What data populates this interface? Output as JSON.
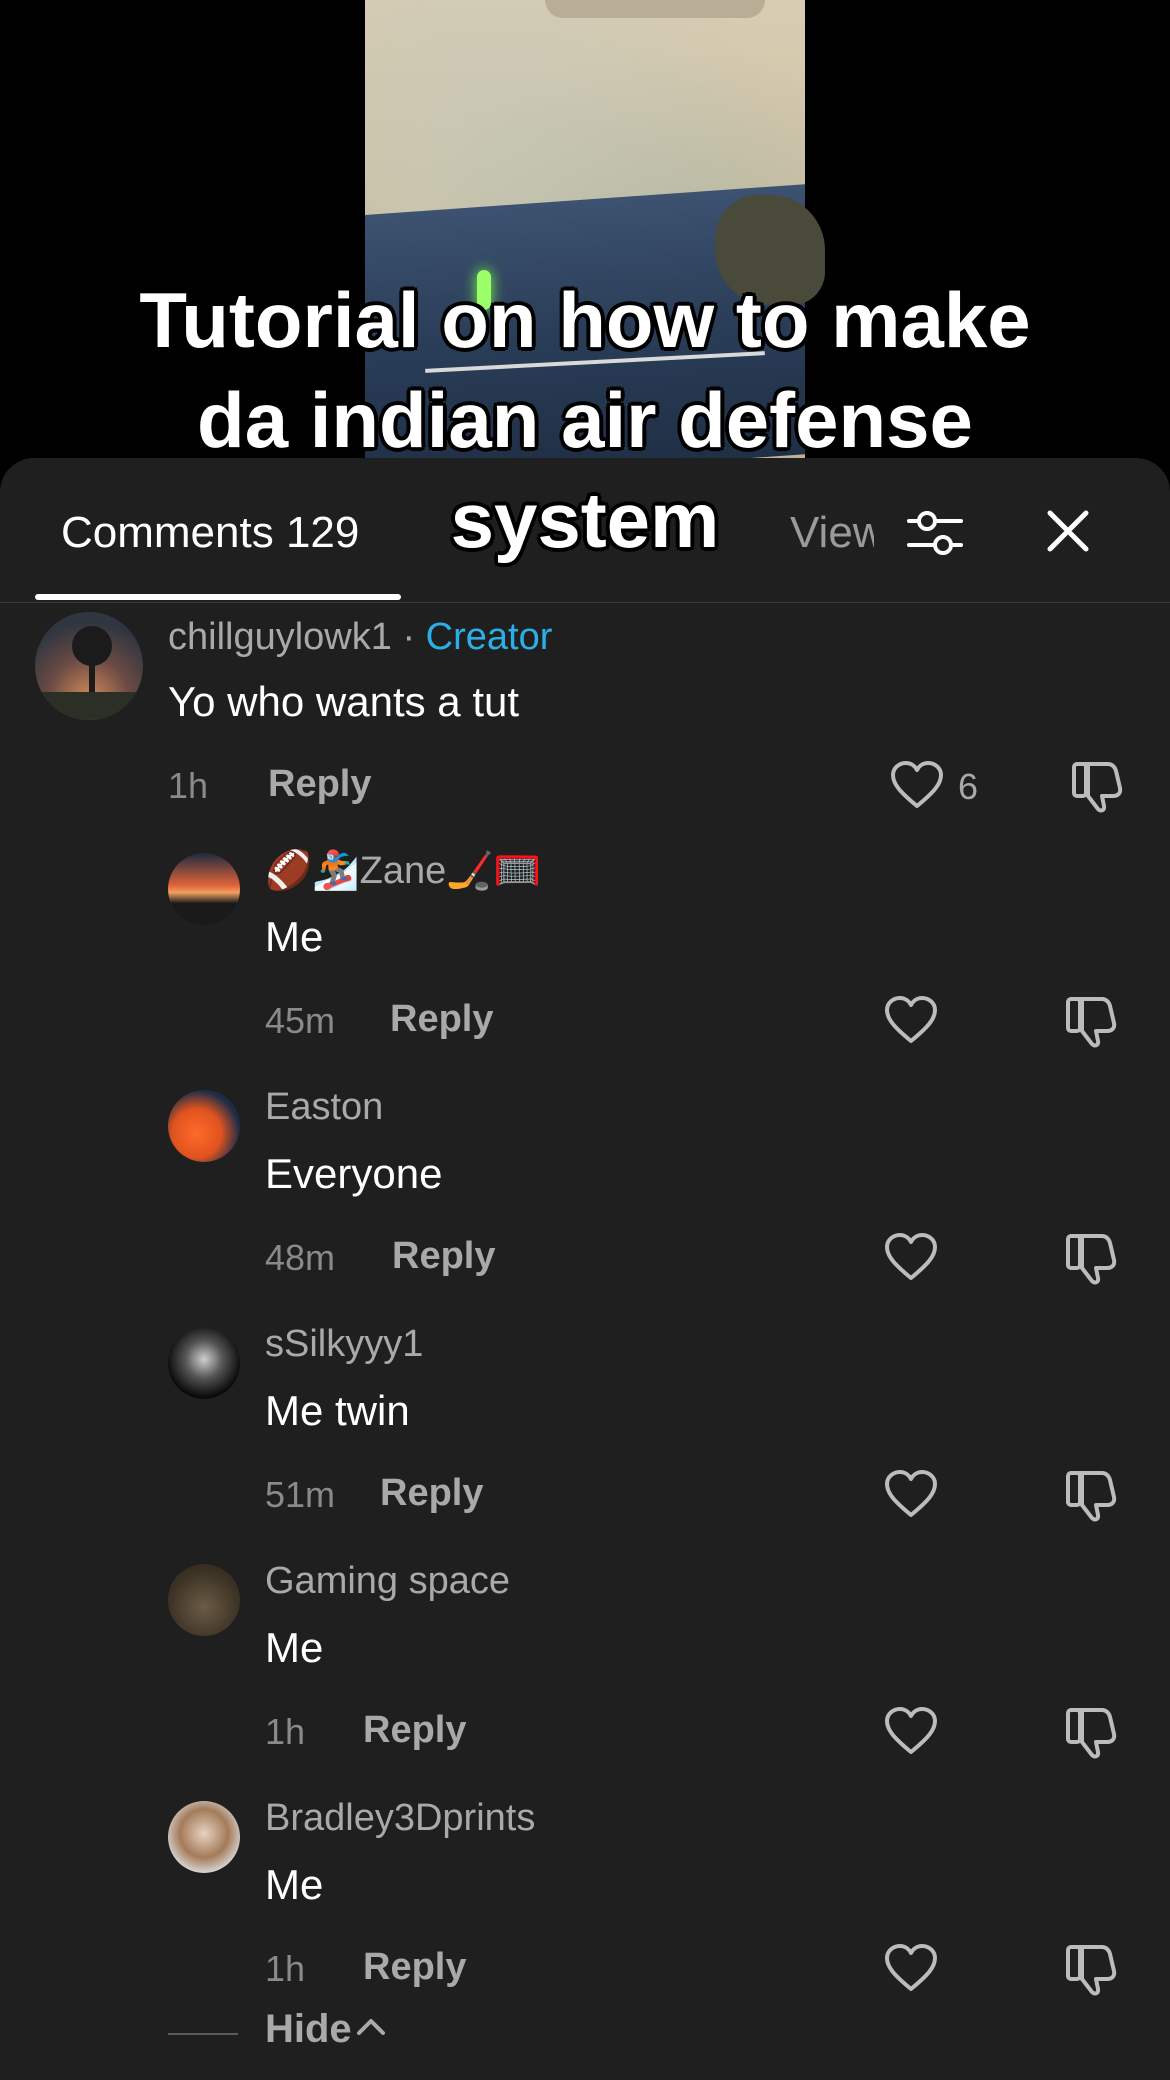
{
  "video": {
    "caption_lines": [
      "Tutorial on how to make",
      "da indian air defense",
      "system"
    ]
  },
  "tabs": {
    "comments": "Comments 129",
    "middle": "...",
    "views": "Views"
  },
  "colors": {
    "panel_bg": "#1f1f1f",
    "creator_accent": "#2ab0e6"
  },
  "comments": [
    {
      "username": "chillguylowk1",
      "separator": "·",
      "badge": "Creator",
      "text": "Yo who wants a tut",
      "time": "1h",
      "reply": "Reply",
      "likes": "6"
    }
  ],
  "replies": [
    {
      "username": "🏈🏂Zane🏒🥅",
      "text": "Me",
      "time": "45m",
      "reply": "Reply"
    },
    {
      "username": "Easton",
      "text": "Everyone",
      "time": "48m",
      "reply": "Reply"
    },
    {
      "username": "sSilkyyy1",
      "text": "Me twin",
      "time": "51m",
      "reply": "Reply"
    },
    {
      "username": "Gaming space",
      "text": "Me",
      "time": "1h",
      "reply": "Reply"
    },
    {
      "username": "Bradley3Dprints",
      "text": "Me",
      "time": "1h",
      "reply": "Reply"
    }
  ],
  "hide_label": "Hide",
  "icons": {
    "filter": "filter-sliders-icon",
    "close": "close-icon",
    "like": "heart-icon",
    "dislike": "thumbs-down-icon",
    "collapse": "chevron-up-icon"
  }
}
